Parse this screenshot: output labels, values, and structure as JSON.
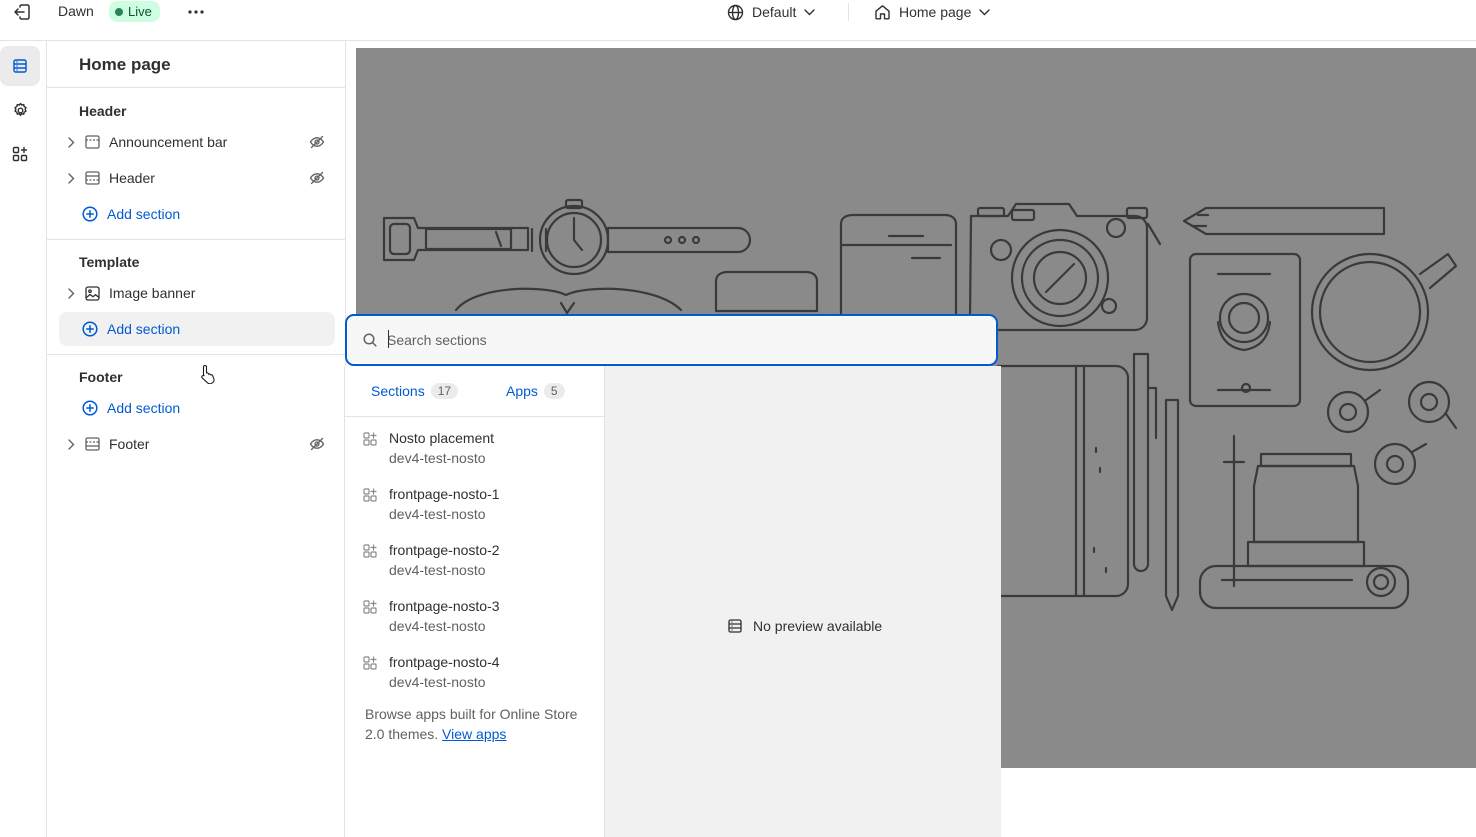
{
  "topbar": {
    "theme_name": "Dawn",
    "status_badge": "Live",
    "context_label": "Default",
    "page_label": "Home page"
  },
  "sidebar": {
    "page_title": "Home page",
    "groups": [
      {
        "title": "Header",
        "items": [
          "Announcement bar",
          "Header"
        ],
        "add_label": "Add section"
      },
      {
        "title": "Template",
        "items": [
          "Image banner"
        ],
        "add_label": "Add section"
      },
      {
        "title": "Footer",
        "items": [
          "Footer"
        ],
        "add_label": "Add section"
      }
    ]
  },
  "search": {
    "placeholder": "Search sections"
  },
  "picker": {
    "tabs": [
      {
        "label": "Sections",
        "count": "17"
      },
      {
        "label": "Apps",
        "count": "5"
      }
    ],
    "items": [
      {
        "name": "Nosto placement",
        "source": "dev4-test-nosto"
      },
      {
        "name": "frontpage-nosto-1",
        "source": "dev4-test-nosto"
      },
      {
        "name": "frontpage-nosto-2",
        "source": "dev4-test-nosto"
      },
      {
        "name": "frontpage-nosto-3",
        "source": "dev4-test-nosto"
      },
      {
        "name": "frontpage-nosto-4",
        "source": "dev4-test-nosto"
      }
    ],
    "browse_text": "Browse apps built for Online Store 2.0 themes.",
    "browse_link": "View apps",
    "no_preview": "No preview available"
  },
  "colors": {
    "accent": "#005bd3",
    "live_badge_bg": "#cdfee1",
    "preview_bg": "#8a8a8a"
  }
}
